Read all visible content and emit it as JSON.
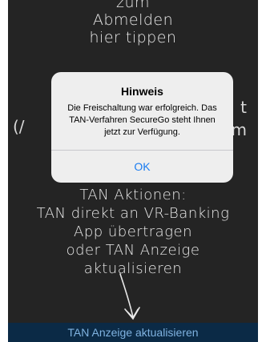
{
  "background": {
    "logout_hint": [
      "zum",
      "Abmelden",
      "hier tippen"
    ],
    "mid_left_fragment": "(/",
    "mid_right_fragment": [
      "t",
      "m"
    ],
    "tan_actions_hint": [
      "TAN Aktionen:",
      "TAN direkt an VR-Banking",
      "App übertragen",
      "oder TAN Anzeige",
      "aktualisieren"
    ]
  },
  "bottom_bar": {
    "refresh_label": "TAN Anzeige aktualisieren"
  },
  "alert": {
    "title": "Hinweis",
    "message": "Die Freischaltung war erfolgreich. Das TAN-Verfahren SecureGo steht Ihnen jetzt zur Verfügung.",
    "ok_label": "OK"
  },
  "colors": {
    "background": "#2a2a2a",
    "bottom_bar": "#0b2a46",
    "accent": "#1a7cf0"
  },
  "icons": {
    "hint_arrow": "hand-drawn-arrow-down-icon"
  }
}
